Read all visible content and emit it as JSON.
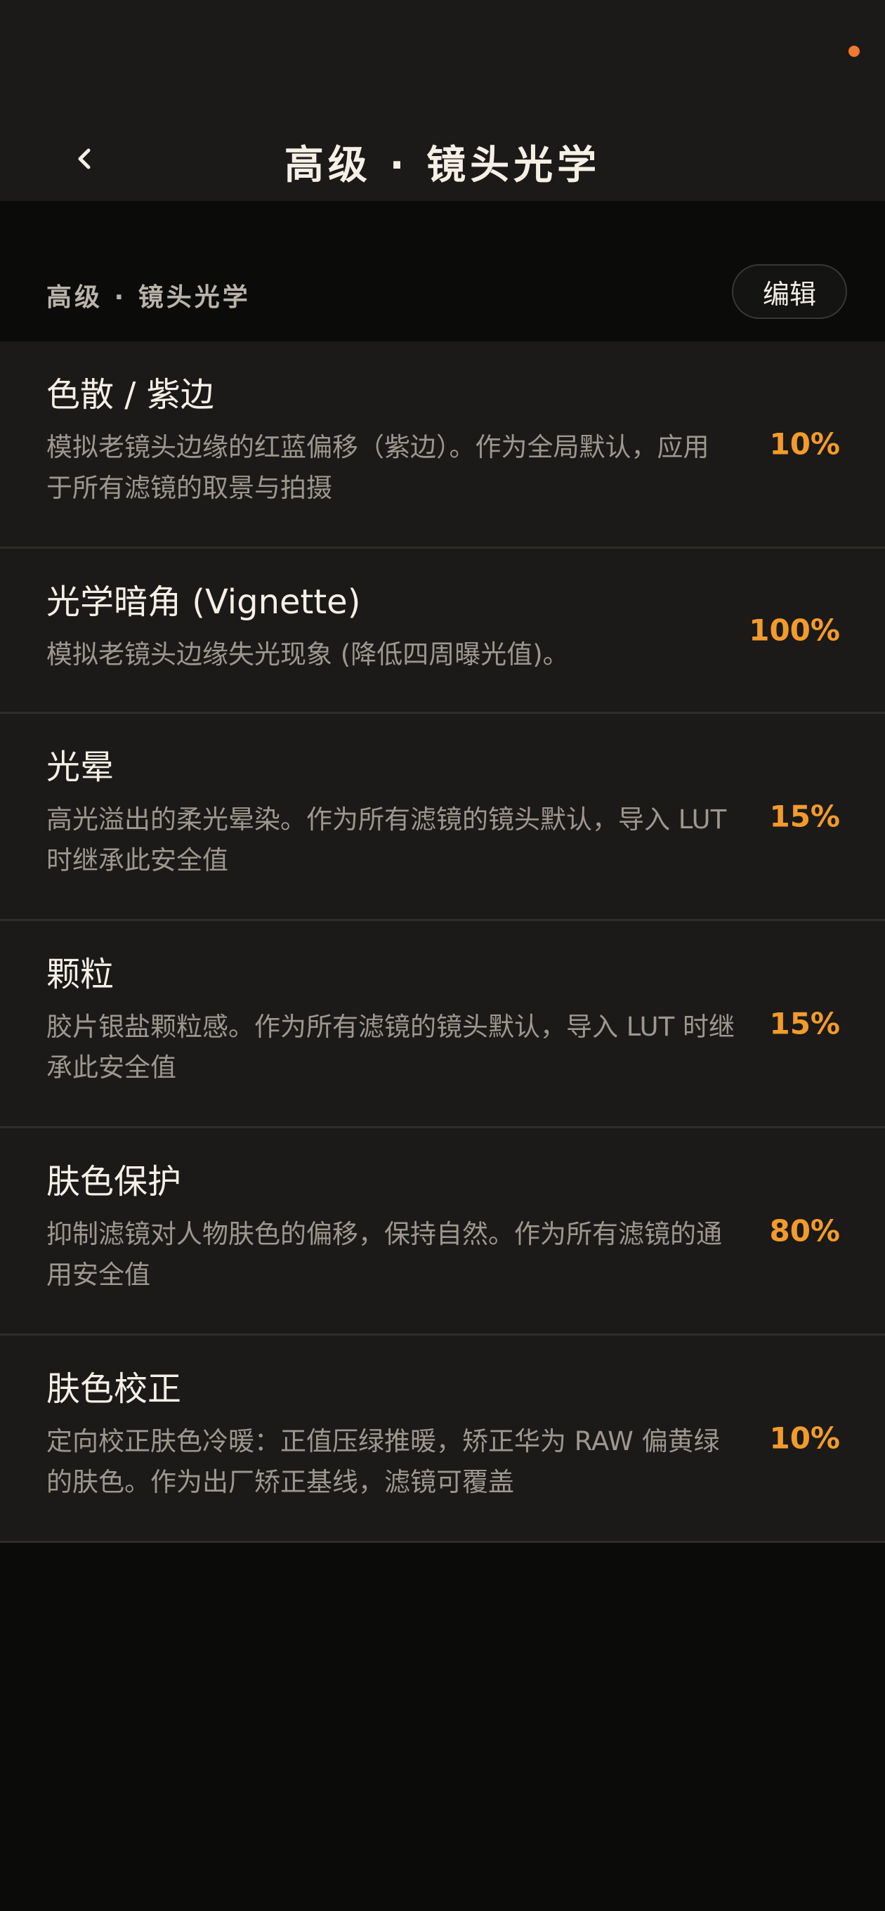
{
  "header": {
    "title": "高级 · 镜头光学"
  },
  "section": {
    "title": "高级 · 镜头光学",
    "edit_label": "编辑"
  },
  "settings": [
    {
      "title": "色散 / 紫边",
      "description": "模拟老镜头边缘的红蓝偏移（紫边）。作为全局默认，应用于所有滤镜的取景与拍摄",
      "value": "10%"
    },
    {
      "title": "光学暗角 (Vignette)",
      "description": "模拟老镜头边缘失光现象 (降低四周曝光值)。",
      "value": "100%"
    },
    {
      "title": "光晕",
      "description": "高光溢出的柔光晕染。作为所有滤镜的镜头默认，导入 LUT 时继承此安全值",
      "value": "15%"
    },
    {
      "title": "颗粒",
      "description": "胶片银盐颗粒感。作为所有滤镜的镜头默认，导入 LUT 时继承此安全值",
      "value": "15%"
    },
    {
      "title": "肤色保护",
      "description": "抑制滤镜对人物肤色的偏移，保持自然。作为所有滤镜的通用安全值",
      "value": "80%"
    },
    {
      "title": "肤色校正",
      "description": "定向校正肤色冷暖：正值压绿推暖，矫正华为 RAW 偏黄绿的肤色。作为出厂矫正基线，滤镜可覆盖",
      "value": "10%"
    }
  ],
  "colors": {
    "accent": "#f29b2c",
    "status_dot": "#f0792f",
    "background": "#0b0b0a",
    "row_background": "#1b1a18"
  },
  "icons": {
    "back": "chevron-left-icon"
  }
}
